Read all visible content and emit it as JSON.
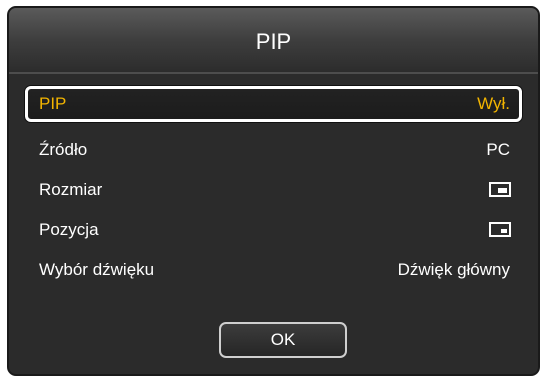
{
  "dialog": {
    "title": "PIP"
  },
  "menu": {
    "items": [
      {
        "label": "PIP",
        "value": "Wył."
      },
      {
        "label": "Źródło",
        "value": "PC"
      },
      {
        "label": "Rozmiar",
        "value_icon": "pip-size-icon"
      },
      {
        "label": "Pozycja",
        "value_icon": "pip-position-icon"
      },
      {
        "label": "Wybór dźwięku",
        "value": "Dźwięk główny"
      }
    ]
  },
  "buttons": {
    "ok_label": "OK"
  },
  "colors": {
    "accent": "#f2b400",
    "text": "#ffffff",
    "background": "#2b2b2b"
  }
}
